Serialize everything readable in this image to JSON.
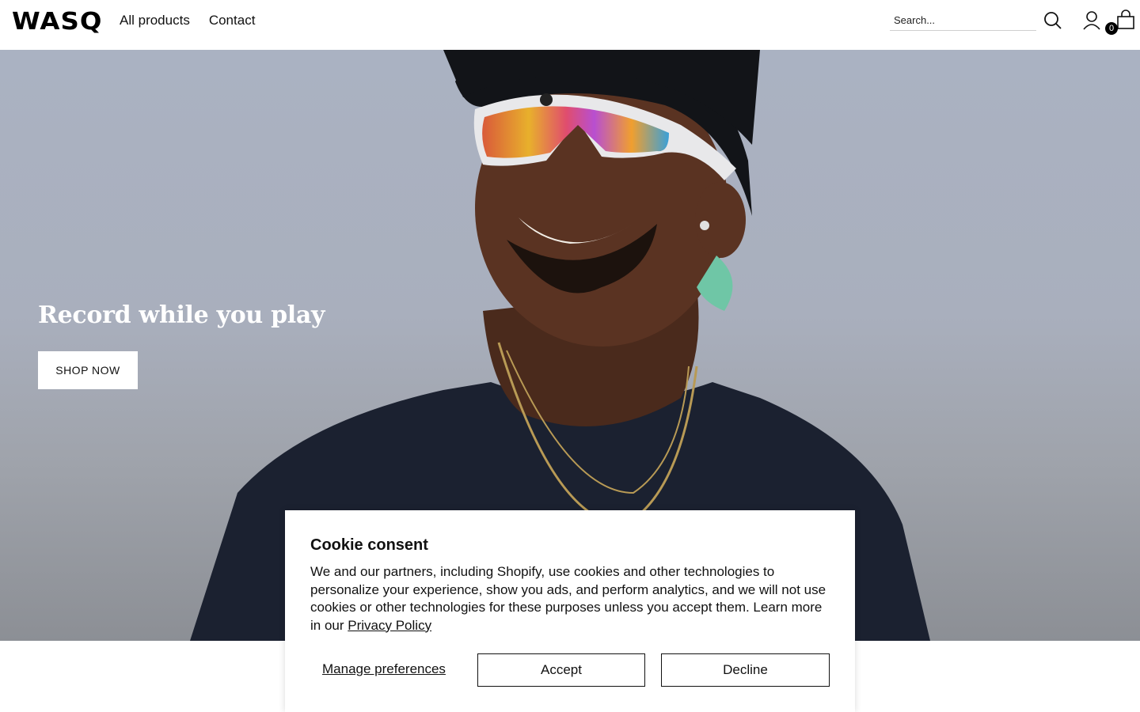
{
  "header": {
    "logo": "WASQ",
    "nav": [
      "All products",
      "Contact"
    ],
    "search_placeholder": "Search...",
    "cart_count": "0",
    "icons": [
      "search-icon",
      "account-icon",
      "cart-icon"
    ]
  },
  "hero": {
    "title": "Record while you play",
    "cta_label": "SHOP NOW"
  },
  "cookie": {
    "title": "Cookie consent",
    "body": "We and our partners, including Shopify, use cookies and other technologies to personalize your experience, show you ads, and perform analytics, and we will not use cookies or other technologies for these purposes unless you accept them. Learn more in our",
    "link": "Privacy Policy",
    "manage_label": "Manage preferences",
    "accept_label": "Accept",
    "decline_label": "Decline"
  }
}
